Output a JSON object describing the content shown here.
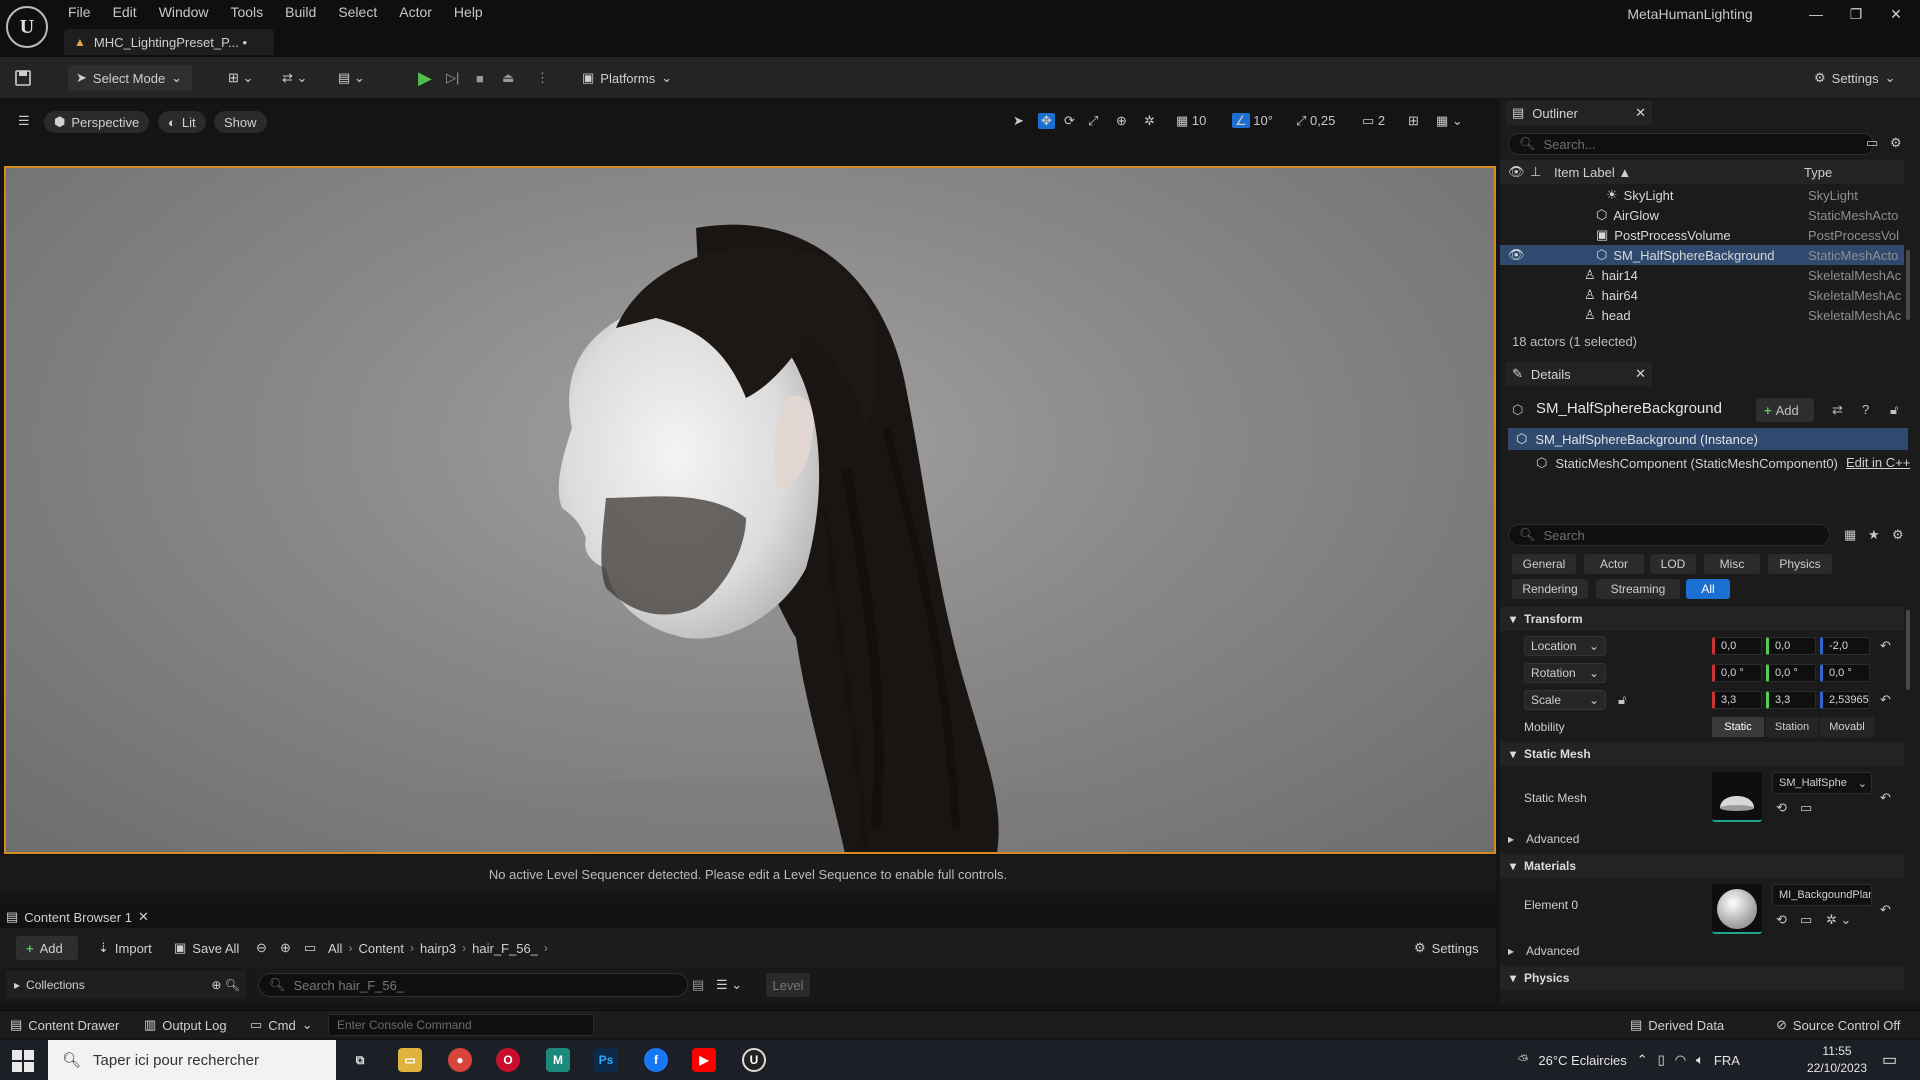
{
  "titlebar": {
    "menus": [
      "File",
      "Edit",
      "Window",
      "Tools",
      "Build",
      "Select",
      "Actor",
      "Help"
    ],
    "document_tab": "MHC_LightingPreset_P... •",
    "project_name": "MetaHumanLighting"
  },
  "toolbar": {
    "select_mode": "Select Mode",
    "platforms": "Platforms",
    "settings": "Settings"
  },
  "viewport": {
    "perspective": "Perspective",
    "lit": "Lit",
    "show": "Show",
    "grid_snap": "10",
    "angle_snap": "10°",
    "scale_snap": "0,25",
    "camera_speed": "2",
    "sequencer_message": "No active Level Sequencer detected. Please edit a Level Sequence to enable full controls."
  },
  "content_browser": {
    "tab": "Content Browser 1",
    "add": "Add",
    "import": "Import",
    "save_all": "Save All",
    "breadcrumbs": [
      "All",
      "Content",
      "hairp3",
      "hair_F_56_"
    ],
    "settings": "Settings",
    "collections": "Collections",
    "search_placeholder": "Search hair_F_56_",
    "level": "Level"
  },
  "bottombar": {
    "content_drawer": "Content Drawer",
    "output_log": "Output Log",
    "cmd": "Cmd",
    "console_placeholder": "Enter Console Command",
    "derived_data": "Derived Data",
    "source_control": "Source Control Off"
  },
  "outliner": {
    "tab": "Outliner",
    "search_placeholder": "Search...",
    "col_label": "Item Label ▲",
    "col_type": "Type",
    "rows": [
      {
        "label": "SkyLight",
        "type": "SkyLight"
      },
      {
        "label": "AirGlow",
        "type": "StaticMeshActo"
      },
      {
        "label": "PostProcessVolume",
        "type": "PostProcessVol"
      },
      {
        "label": "SM_HalfSphereBackground",
        "type": "StaticMeshActo"
      },
      {
        "label": "hair14",
        "type": "SkeletalMeshAc"
      },
      {
        "label": "hair64",
        "type": "SkeletalMeshAc"
      },
      {
        "label": "head",
        "type": "SkeletalMeshAc"
      }
    ],
    "footer": "18 actors (1 selected)"
  },
  "details": {
    "tab": "Details",
    "actor_name": "SM_HalfSphereBackground",
    "add": "Add",
    "instance": "SM_HalfSphereBackground (Instance)",
    "component": "StaticMeshComponent (StaticMeshComponent0)",
    "edit_cpp": "Edit in C++",
    "search_placeholder": "Search",
    "filters": [
      "General",
      "Actor",
      "LOD",
      "Misc",
      "Physics",
      "Rendering",
      "Streaming",
      "All"
    ],
    "transform": {
      "title": "Transform",
      "location_label": "Location",
      "location": [
        "0,0",
        "0,0",
        "-2,0"
      ],
      "rotation_label": "Rotation",
      "rotation": [
        "0,0 °",
        "0,0 °",
        "0,0 °"
      ],
      "scale_label": "Scale",
      "scale": [
        "3,3",
        "3,3",
        "2,53965"
      ],
      "mobility_label": "Mobility",
      "mobility": [
        "Static",
        "Station",
        "Movabl"
      ]
    },
    "static_mesh": {
      "title": "Static Mesh",
      "label": "Static Mesh",
      "asset": "SM_HalfSphe",
      "advanced": "Advanced"
    },
    "materials": {
      "title": "Materials",
      "element": "Element 0",
      "asset": "MI_BackgoundPlane",
      "advanced": "Advanced"
    },
    "physics": {
      "title": "Physics"
    }
  },
  "taskbar": {
    "search_placeholder": "Taper ici pour rechercher",
    "weather": "26°C  Eclaircies",
    "lang": "FRA",
    "time": "11:55",
    "date": "22/10/2023"
  },
  "colors": {
    "accent": "#1b6fd1",
    "viewport_border": "#d38a1e",
    "selection": "#2f4a6e"
  }
}
